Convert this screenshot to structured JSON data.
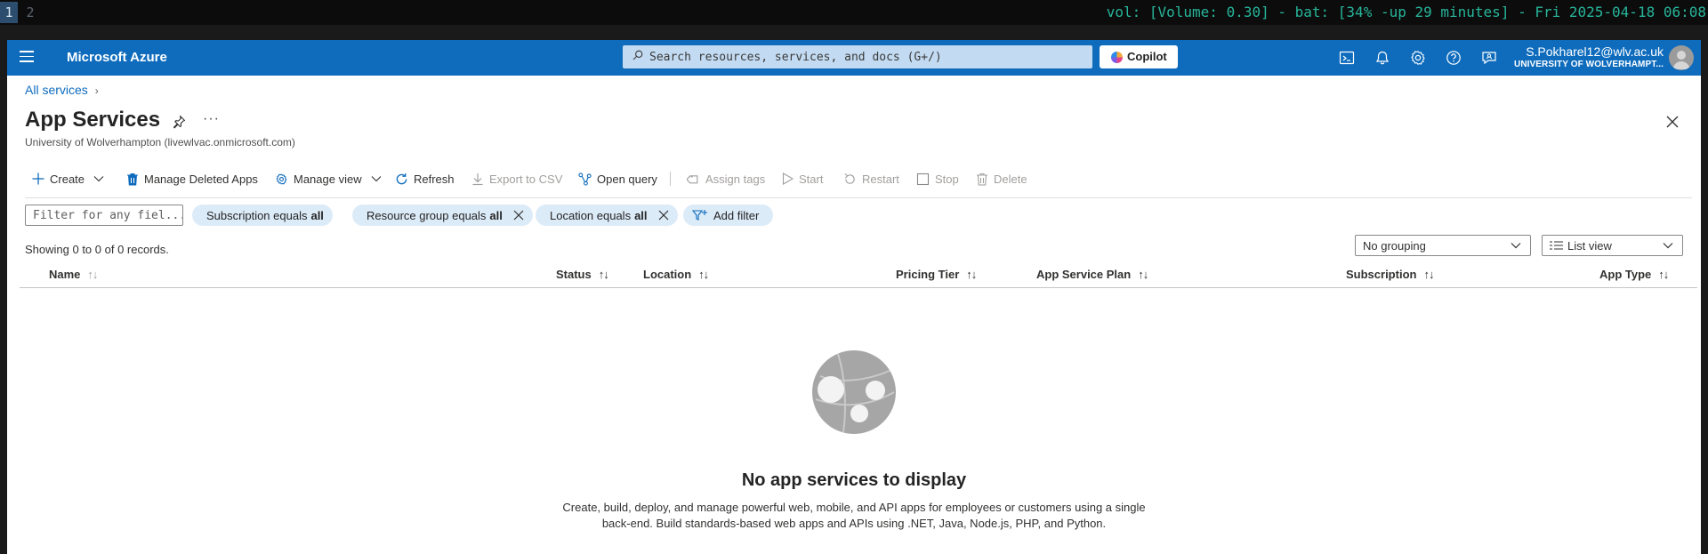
{
  "system_bar": {
    "workspaces": [
      "1",
      "2"
    ],
    "status_text": "vol: [Volume: 0.30] - bat: [34% -up 29 minutes] - Fri 2025-04-18 06:08"
  },
  "header": {
    "brand": "Microsoft Azure",
    "search_placeholder": "Search resources, services, and docs (G+/)",
    "copilot_label": "Copilot",
    "user_email": "S.Pokharel12@wlv.ac.uk",
    "user_org": "UNIVERSITY OF WOLVERHAMPT..."
  },
  "breadcrumb": {
    "root": "All services",
    "separator": "›"
  },
  "page": {
    "title": "App Services",
    "more": "···",
    "subtitle": "University of Wolverhampton (livewlvac.onmicrosoft.com)"
  },
  "toolbar": {
    "create": "Create",
    "manage_deleted": "Manage Deleted Apps",
    "manage_view": "Manage view",
    "refresh": "Refresh",
    "export_csv": "Export to CSV",
    "open_query": "Open query",
    "assign_tags": "Assign tags",
    "start": "Start",
    "restart": "Restart",
    "stop": "Stop",
    "delete": "Delete"
  },
  "filters": {
    "placeholder": "Filter for any fiel...",
    "pills": [
      {
        "label": "Subscription equals",
        "value": "all"
      },
      {
        "label": "Resource group equals",
        "value": "all"
      },
      {
        "label": "Location equals",
        "value": "all"
      }
    ],
    "add_filter": "Add filter"
  },
  "records_text": "Showing 0 to 0 of 0 records.",
  "grouping": {
    "selected": "No grouping"
  },
  "view": {
    "selected": "List view"
  },
  "columns": [
    "Name",
    "Status",
    "Location",
    "Pricing Tier",
    "App Service Plan",
    "Subscription",
    "App Type"
  ],
  "sort_glyph": "↑↓",
  "empty_state": {
    "title": "No app services to display",
    "description": "Create, build, deploy, and manage powerful web, mobile, and API apps for employees or customers using a single back-end. Build standards-based web apps and APIs using .NET, Java, Node.js, PHP, and Python."
  },
  "colors": {
    "azure_blue": "#0f6cbd",
    "pill_bg": "#dcebf8",
    "status_green": "#27b59a"
  }
}
